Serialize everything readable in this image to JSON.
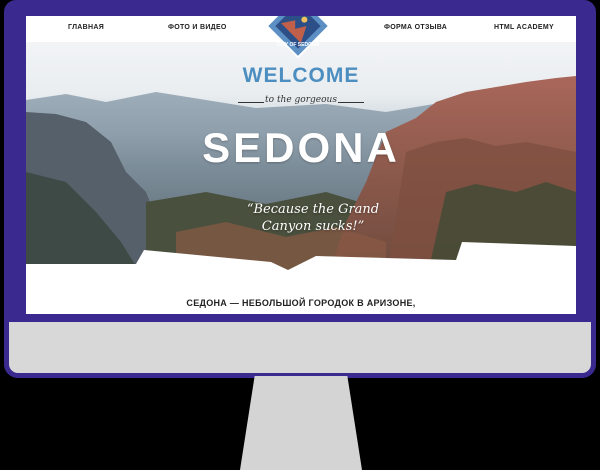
{
  "nav": {
    "items": [
      "ГЛАВНАЯ",
      "ФОТО И ВИДЕО",
      "ФОРМА ОТЗЫВА",
      "HTML ACADEMY"
    ]
  },
  "badge": {
    "text": "CITY OF SEDONA"
  },
  "hero": {
    "welcome": "WELCOME",
    "subwelcome": "to the gorgeous",
    "title": "SEDONA",
    "tagline_line1": "“Because the Grand",
    "tagline_line2": "Canyon sucks!”"
  },
  "content": {
    "subtitle": "СЕДОНА — НЕБОЛЬШОЙ ГОРОДОК В АРИЗОНЕ,"
  },
  "colors": {
    "monitor_frame": "#3a2a8f",
    "welcome": "#4d8ec0",
    "badge_bg": "#5c8fc4",
    "badge_inner": "#2d4f87"
  }
}
